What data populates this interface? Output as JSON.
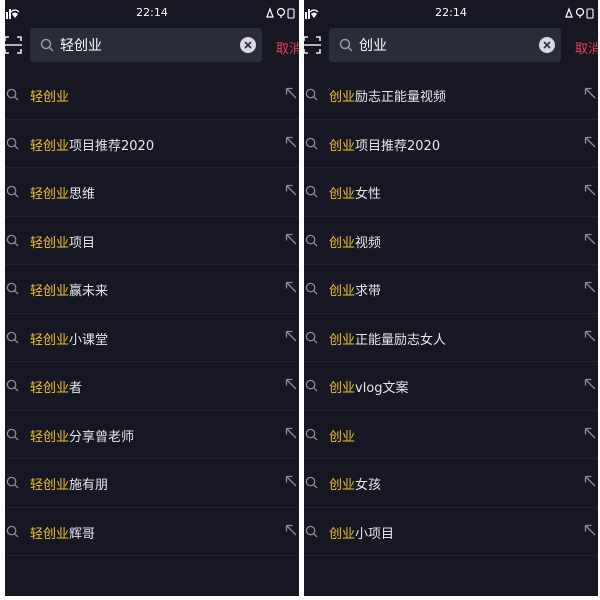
{
  "colors": {
    "background": "#161722",
    "highlight": "#f0c21b",
    "cancel": "#ec3c55",
    "search_box": "#2a2c38"
  },
  "icons": {
    "scan": "scan-icon",
    "search": "search-icon",
    "clear": "clear-icon",
    "fill": "arrow-up-left-icon"
  },
  "panels": [
    {
      "time": "22:14",
      "query": "轻创业",
      "cancel_label": "取消",
      "suggestions": [
        {
          "match": "轻创业",
          "rest": ""
        },
        {
          "match": "轻创业",
          "rest": "项目推荐2020"
        },
        {
          "match": "轻创业",
          "rest": "思维"
        },
        {
          "match": "轻创业",
          "rest": "项目"
        },
        {
          "match": "轻创业",
          "rest": "赢未来"
        },
        {
          "match": "轻创业",
          "rest": "小课堂"
        },
        {
          "match": "轻创业",
          "rest": "者"
        },
        {
          "match": "轻创业",
          "rest": "分享曾老师"
        },
        {
          "match": "轻创业",
          "rest": "施有朋"
        },
        {
          "match": "轻创业",
          "rest": "辉哥"
        }
      ]
    },
    {
      "time": "22:14",
      "query": "创业",
      "cancel_label": "取消",
      "suggestions": [
        {
          "match": "创业",
          "rest": "励志正能量视频"
        },
        {
          "match": "创业",
          "rest": "项目推荐2020"
        },
        {
          "match": "创业",
          "rest": "女性"
        },
        {
          "match": "创业",
          "rest": "视频"
        },
        {
          "match": "创业",
          "rest": "求带"
        },
        {
          "match": "创业",
          "rest": "正能量励志女人"
        },
        {
          "match": "创业",
          "rest": "vlog文案"
        },
        {
          "match": "创业",
          "rest": ""
        },
        {
          "match": "创业",
          "rest": "女孩"
        },
        {
          "match": "创业",
          "rest": "小项目"
        }
      ]
    }
  ]
}
